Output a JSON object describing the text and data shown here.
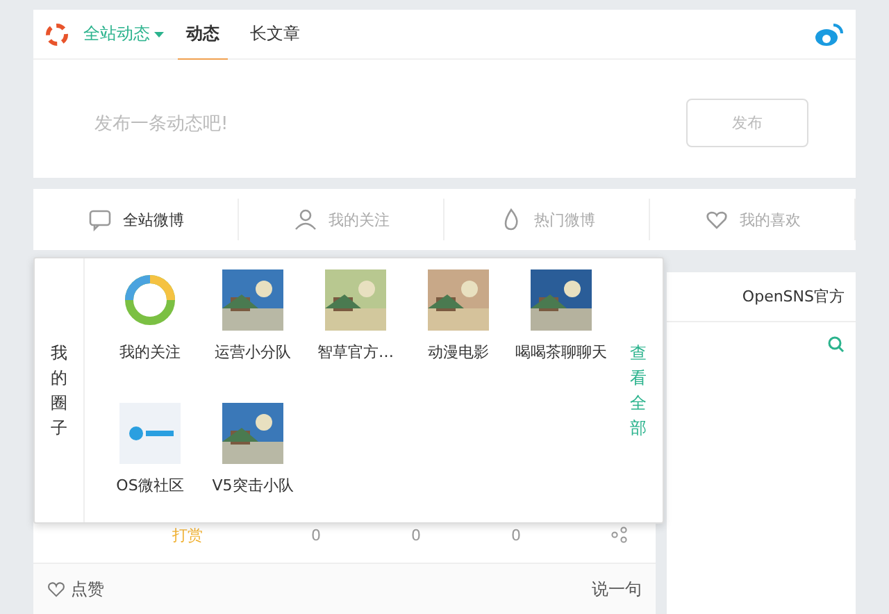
{
  "header": {
    "scope": "全站动态",
    "tabs": [
      {
        "label": "动态",
        "selected": true
      },
      {
        "label": "长文章",
        "selected": false
      }
    ]
  },
  "composer": {
    "placeholder": "发布一条动态吧!",
    "button": "发布"
  },
  "feed_tabs": [
    {
      "label": "全站微博",
      "selected": true
    },
    {
      "label": "我的关注",
      "selected": false
    },
    {
      "label": "热门微博",
      "selected": false
    },
    {
      "label": "我的喜欢",
      "selected": false
    }
  ],
  "side": {
    "title": "OpenSNS官方"
  },
  "circles": {
    "title": "我的圈子",
    "more": "查看全部",
    "items": [
      {
        "name": "我的关注",
        "kind": "ring"
      },
      {
        "name": "运营小分队",
        "kind": "picture"
      },
      {
        "name": "智草官方…",
        "kind": "picture"
      },
      {
        "name": "动漫电影",
        "kind": "picture"
      },
      {
        "name": "喝喝茶聊聊天",
        "kind": "picture"
      },
      {
        "name": "OS微社区",
        "kind": "logo"
      },
      {
        "name": "V5突击小队",
        "kind": "picture"
      }
    ]
  },
  "post_actions": {
    "reward": "打赏",
    "likes": "0",
    "comments": "0",
    "reposts": "0"
  },
  "reply_bar": {
    "like": "点赞",
    "reply": "说一句"
  }
}
